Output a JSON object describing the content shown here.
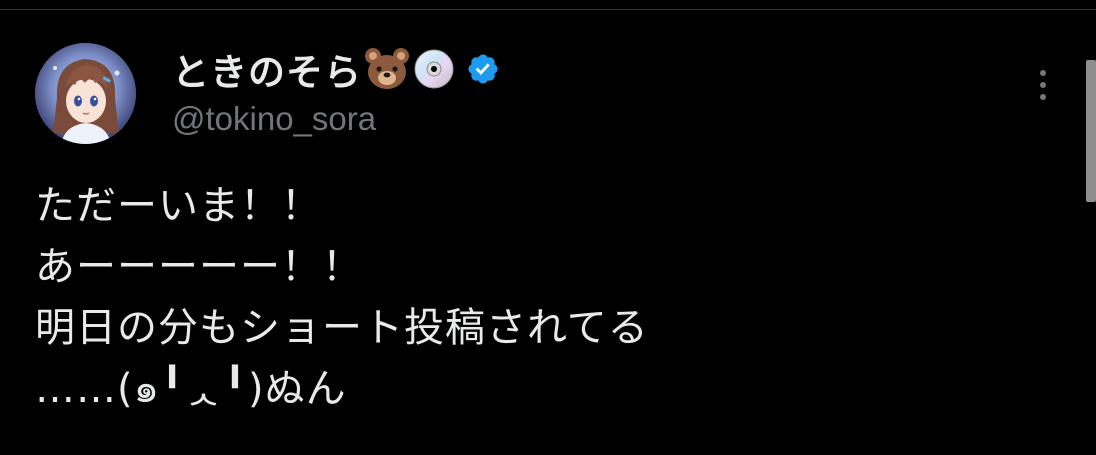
{
  "tweet": {
    "author": {
      "display_name": "ときのそら",
      "name_emojis": [
        "bear-face-emoji",
        "dvd-disc-emoji"
      ],
      "verified": true,
      "handle": "@tokino_sora"
    },
    "menu_icon": "more-vertical-icon",
    "lines": [
      "ただーいま！！",
      "あーーーーー！！",
      "明日の分もショート投稿されてる",
      "……(๑╹ᆺ╹)ぬん"
    ]
  },
  "colors": {
    "background": "#000000",
    "text_primary": "#e7e9ea",
    "text_secondary": "#71767b",
    "verified_blue": "#1d9bf0",
    "divider": "#2f3336"
  }
}
